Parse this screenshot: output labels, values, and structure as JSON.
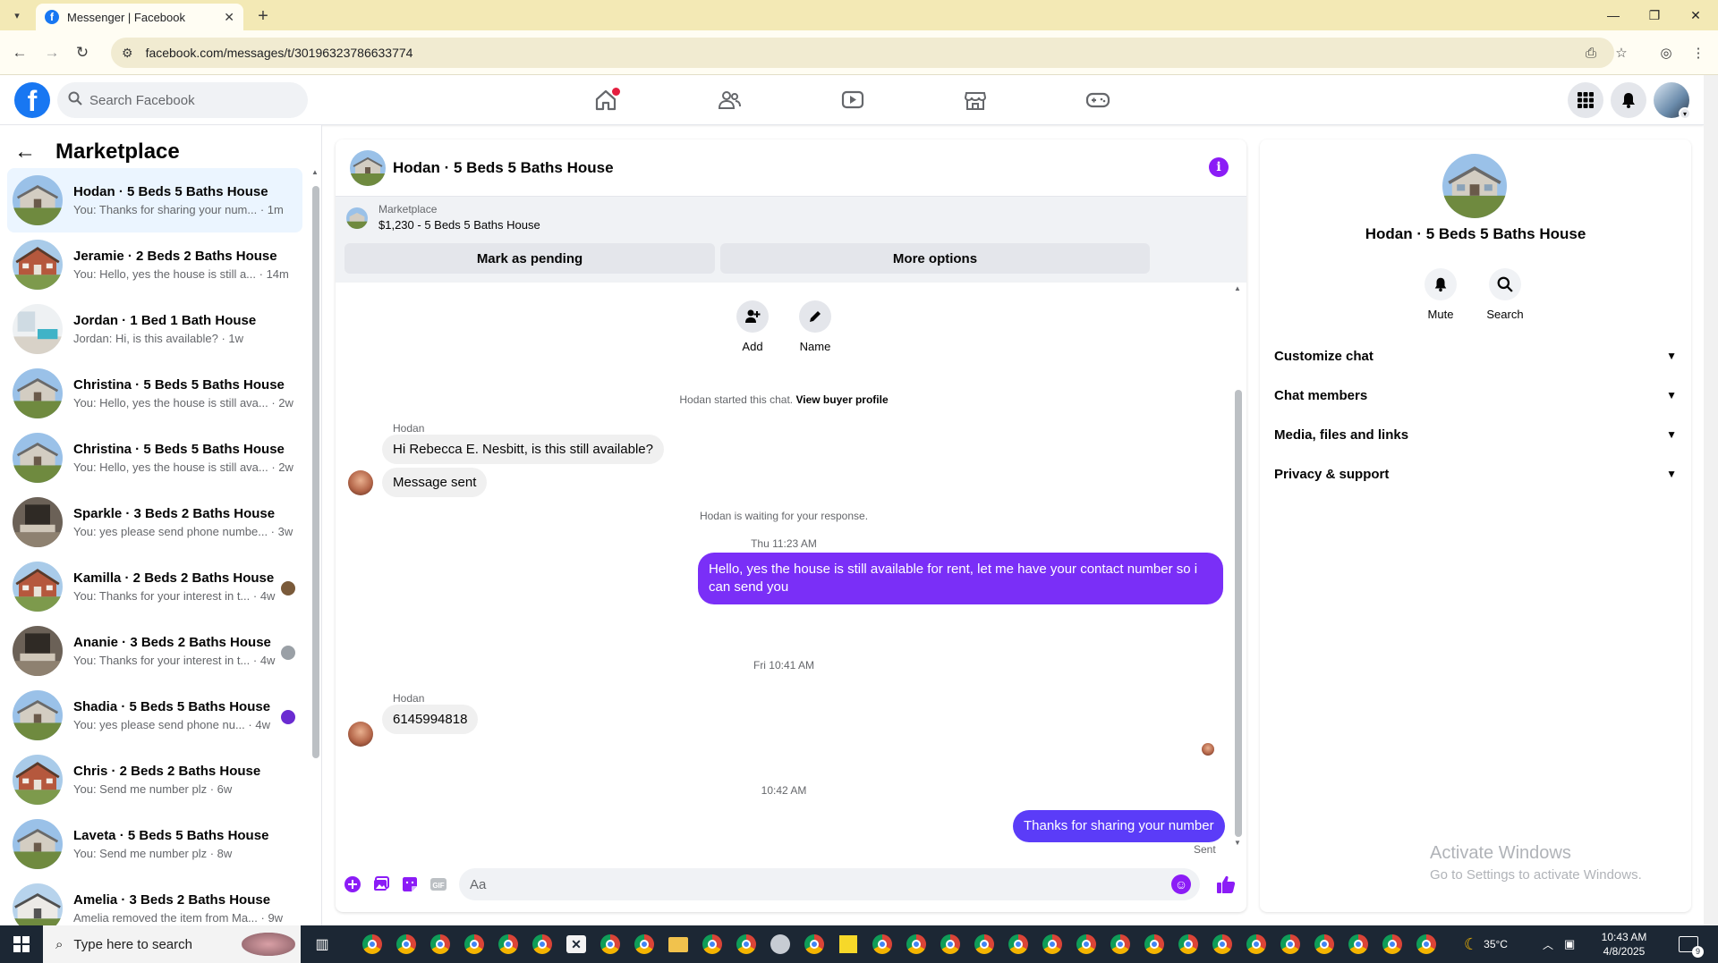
{
  "browser": {
    "tab_title": "Messenger | Facebook",
    "url": "facebook.com/messages/t/30196323786633774"
  },
  "fb": {
    "search_placeholder": "Search Facebook"
  },
  "sidebar": {
    "title": "Marketplace",
    "conversations": [
      {
        "name": "Hodan · 5 Beds 5 Baths House",
        "preview": "You: Thanks for sharing your num... · 1m",
        "thumb": "house-gray"
      },
      {
        "name": "Jeramie · 2 Beds 2 Baths House",
        "preview": "You: Hello, yes the house is still a... · 14m",
        "thumb": "house-brick"
      },
      {
        "name": "Jordan · 1 Bed 1 Bath House",
        "preview": "Jordan: Hi, is this available? · 1w",
        "thumb": "room-white"
      },
      {
        "name": "Christina · 5 Beds 5 Baths House",
        "preview": "You: Hello, yes the house is still ava... · 2w",
        "thumb": "house-gray"
      },
      {
        "name": "Christina · 5 Beds 5 Baths House",
        "preview": "You: Hello, yes the house is still ava... · 2w",
        "thumb": "house-gray"
      },
      {
        "name": "Sparkle · 3 Beds 2 Baths House",
        "preview": "You: yes please send phone numbe... · 3w",
        "thumb": "room-dark"
      },
      {
        "name": "Kamilla · 2 Beds 2 Baths House",
        "preview": "You: Thanks for your interest in t... · 4w",
        "thumb": "house-brick"
      },
      {
        "name": "Ananie · 3 Beds 2 Baths House",
        "preview": "You: Thanks for your interest in t... · 4w",
        "thumb": "room-dark"
      },
      {
        "name": "Shadia · 5 Beds 5 Baths House",
        "preview": "You: yes please send phone nu... · 4w",
        "thumb": "house-gray"
      },
      {
        "name": "Chris · 2 Beds 2 Baths House",
        "preview": "You: Send me number plz · 6w",
        "thumb": "house-brick"
      },
      {
        "name": "Laveta · 5 Beds 5 Baths House",
        "preview": "You: Send me number plz · 8w",
        "thumb": "house-gray"
      },
      {
        "name": "Amelia · 3 Beds 2 Baths House",
        "preview": "Amelia removed the item from Ma... · 9w",
        "thumb": "house-white"
      }
    ]
  },
  "chat": {
    "title": "Hodan · 5 Beds 5 Baths House",
    "marketplace_label": "Marketplace",
    "listing": "$1,230 - 5 Beds 5 Baths House",
    "mark_pending": "Mark as pending",
    "more_options": "More options",
    "add_label": "Add",
    "name_label": "Name",
    "started_text": "Hodan started this chat.",
    "view_profile": "View buyer profile",
    "sender1": "Hodan",
    "msg1": "Hi Rebecca E. Nesbitt, is this still available?",
    "msg2": "Message sent",
    "waiting": "Hodan is waiting for your response.",
    "time1": "Thu 11:23 AM",
    "reply1": "Hello, yes the house is still available for rent, let me have your contact number so i can send you",
    "time2": "Fri 10:41 AM",
    "sender2": "Hodan",
    "msg3": "6145994818",
    "time3": "10:42 AM",
    "reply2": "Thanks for sharing your number",
    "sent_status": "Sent",
    "composer_placeholder": "Aa"
  },
  "right_panel": {
    "name": "Hodan · 5 Beds 5 Baths House",
    "mute": "Mute",
    "search": "Search",
    "sections": [
      "Customize chat",
      "Chat members",
      "Media, files and links",
      "Privacy & support"
    ],
    "watermark_title": "Activate Windows",
    "watermark_sub": "Go to Settings to activate Windows."
  },
  "taskbar": {
    "search_placeholder": "Type here to search",
    "weather": "35°C",
    "time": "10:43 AM",
    "date": "4/8/2025",
    "notifications": "9"
  },
  "colors": {
    "fb_blue": "#1877f2",
    "accent_purple": "#8b1cf6",
    "bubble_out": "#7a2ff7"
  }
}
